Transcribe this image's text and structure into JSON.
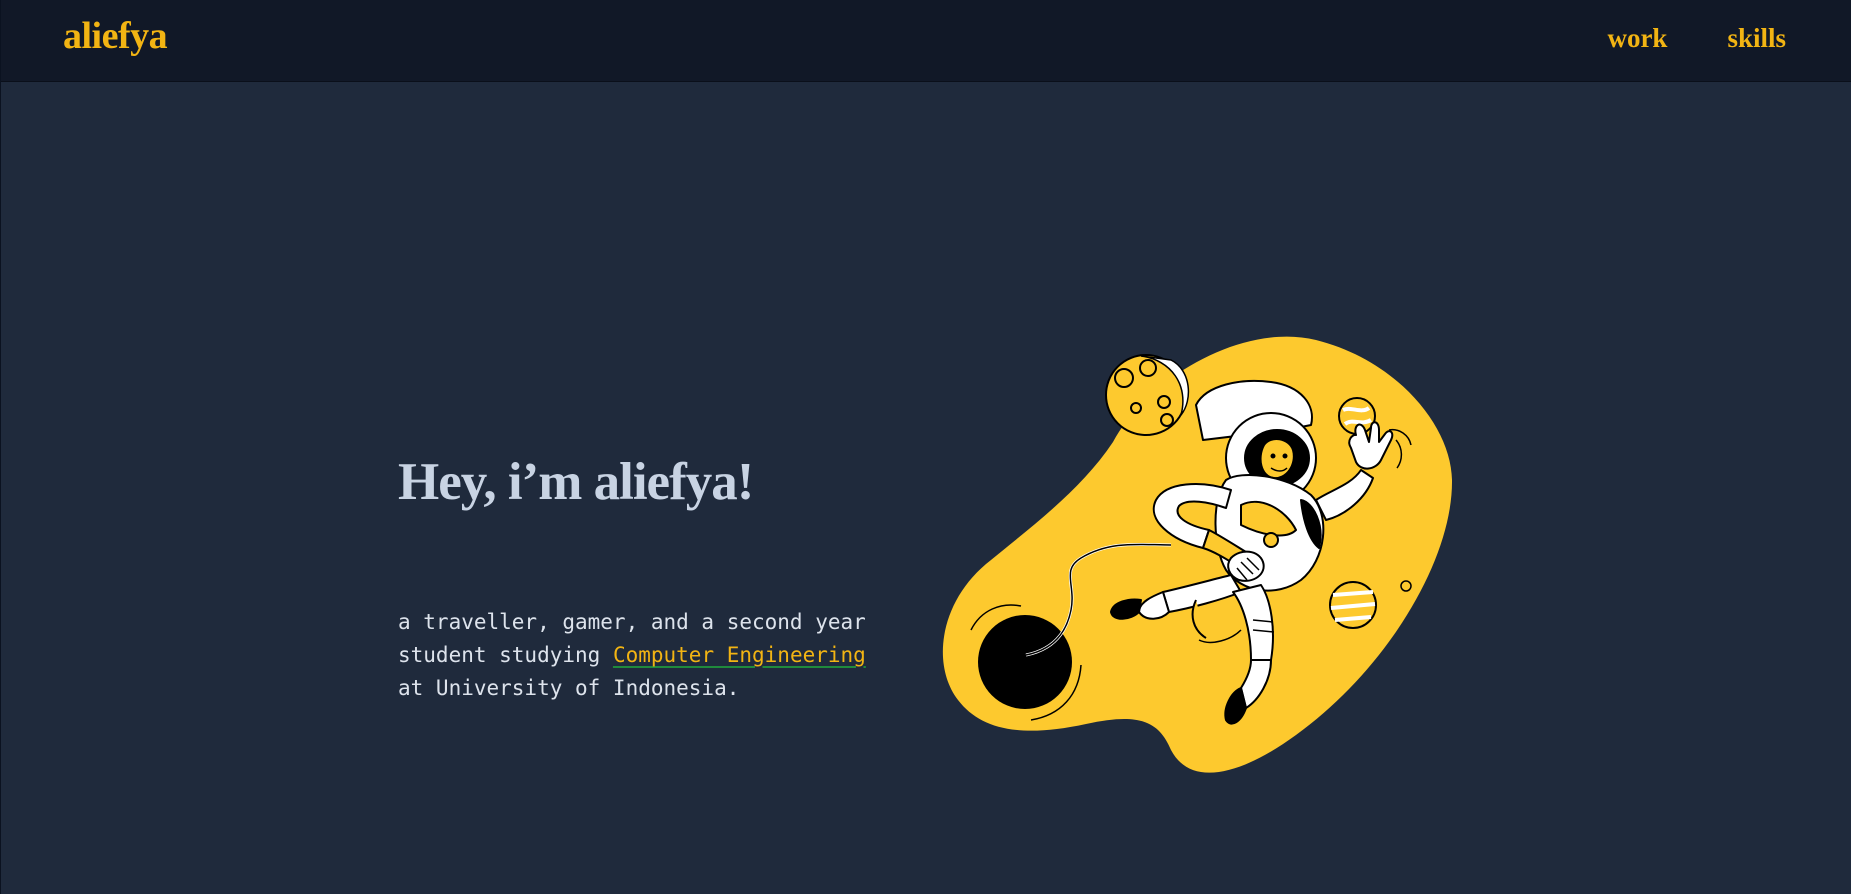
{
  "header": {
    "brand": "aliefya",
    "nav": [
      {
        "label": "work"
      },
      {
        "label": "skills"
      }
    ]
  },
  "hero": {
    "title": "Hey, i’m aliefya!",
    "description_line1": "a traveller, gamer, and a second year",
    "description_line2_prefix": "student studying ",
    "description_link": "Computer Engineering",
    "description_line3": "at University of Indonesia."
  },
  "illustration": {
    "icon": "astronaut-in-space-icon"
  },
  "colors": {
    "background": "#1f2a3c",
    "header_background": "#111827",
    "accent": "#f2b413",
    "blob": "#fdc92e",
    "title": "#c8d3e3",
    "body_text": "#dde3ec",
    "link_underline": "#1f8a3c"
  }
}
